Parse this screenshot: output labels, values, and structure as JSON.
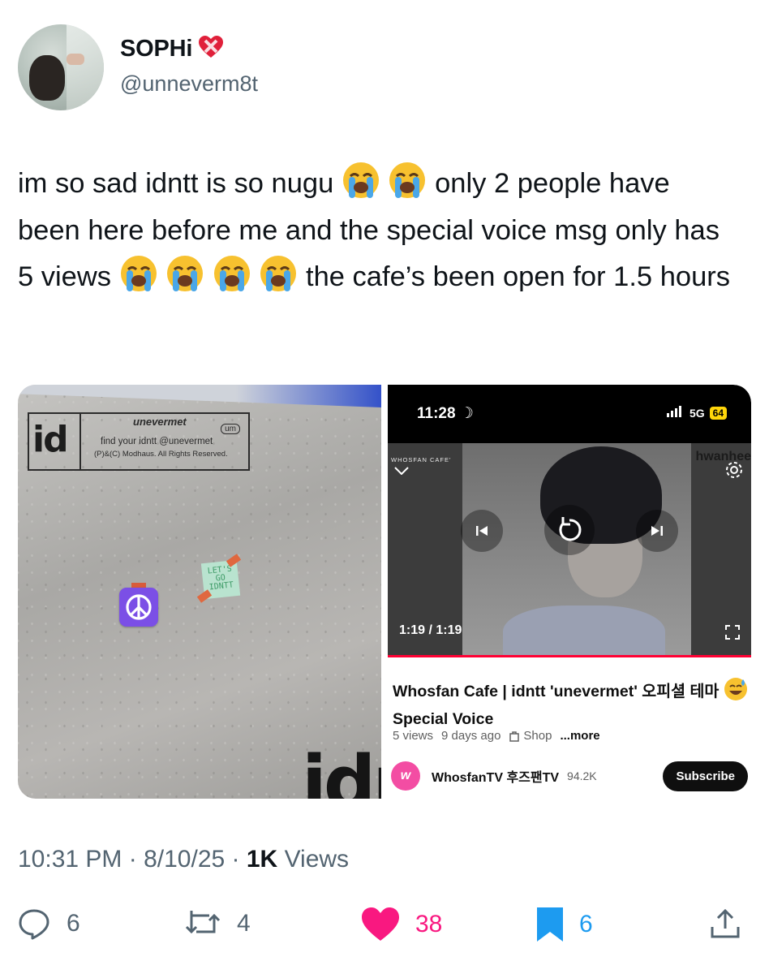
{
  "author": {
    "display_name": "SOPHi",
    "handle": "@unneverm8t",
    "badge_icon": "mending-heart-icon"
  },
  "tweet": {
    "text_parts": [
      "im so sad idntt is so nugu",
      "only 2 people have been here before me and the special voice msg only has 5 views",
      "the cafe’s been open for 1.5 hours"
    ],
    "emoji": "loudly-crying-face"
  },
  "media": {
    "photo": {
      "label_id": "id",
      "label_title": "unevermet",
      "label_badge": "um",
      "label_line1": "find your idntt @unevermet",
      "label_line2": "(P)&(C) Modhaus. All Rights Reserved.",
      "sticker_text": "LET'S GO IDNTT",
      "big_text": "idn"
    },
    "screenshot": {
      "status_time": "11:28",
      "network": "5G",
      "battery": "64",
      "player_brand": "WHOSFAN CAFE'",
      "player_channel": "hwanhee",
      "player_time": "1:19 / 1:19",
      "video_title": "Whosfan Cafe | idntt 'unevermet' 오피셜 테마",
      "video_title_tail": "Special Voice",
      "views": "5 views",
      "age": "9 days ago",
      "shop": "Shop",
      "more": "...more",
      "channel_name": "WhosfanTV 후즈팬TV",
      "channel_subs": "94.2K",
      "subscribe": "Subscribe"
    }
  },
  "meta": {
    "time": "10:31 PM",
    "date": "8/10/25",
    "view_count": "1K",
    "view_label": "Views"
  },
  "actions": {
    "replies": "6",
    "reposts": "4",
    "likes": "38",
    "bookmarks": "6"
  },
  "colors": {
    "like": "#f91880",
    "bookmark": "#1d9bf0",
    "secondary_text": "#536471"
  }
}
